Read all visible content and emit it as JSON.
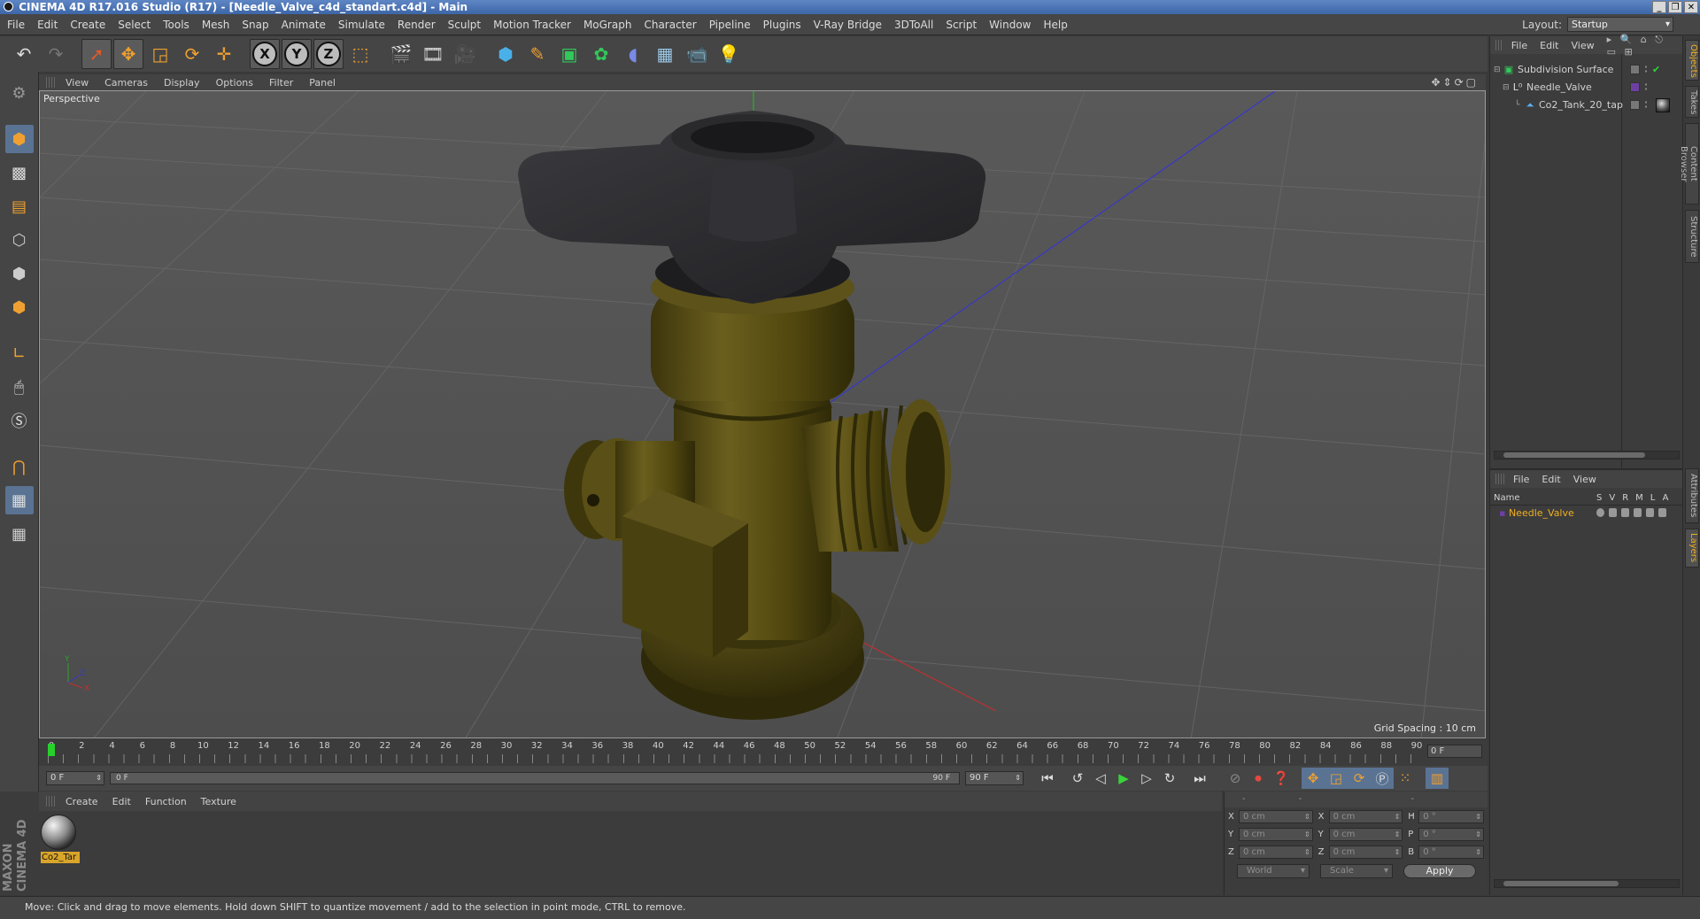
{
  "window": {
    "title": "CINEMA 4D R17.016 Studio (R17) - [Needle_Valve_c4d_standart.c4d] - Main",
    "controls": [
      "_",
      "❐",
      "✕"
    ]
  },
  "menubar": {
    "items": [
      "File",
      "Edit",
      "Create",
      "Select",
      "Tools",
      "Mesh",
      "Snap",
      "Animate",
      "Simulate",
      "Render",
      "Sculpt",
      "Motion Tracker",
      "MoGraph",
      "Character",
      "Pipeline",
      "Plugins",
      "V-Ray Bridge",
      "3DToAll",
      "Script",
      "Window",
      "Help"
    ],
    "layout_label": "Layout:",
    "layout_value": "Startup"
  },
  "toolbar": {
    "axis_x": "X",
    "axis_y": "Y",
    "axis_z": "Z"
  },
  "viewport": {
    "menu": [
      "View",
      "Cameras",
      "Display",
      "Options",
      "Filter",
      "Panel"
    ],
    "label": "Perspective",
    "grid_spacing": "Grid Spacing : 10 cm",
    "nav_icons": "✥⇕⟳▢",
    "axis_x": "X",
    "axis_y": "Y",
    "axis_z": "Z",
    "colors": {
      "knob": "#2b2b2e",
      "body": "#4e4510",
      "body_highlight": "#6b5f1e",
      "x_axis": "#c03030",
      "y_axis": "#30a030",
      "z_axis": "#3838c8"
    }
  },
  "timeline": {
    "ticks": [
      "0",
      "2",
      "4",
      "6",
      "8",
      "10",
      "12",
      "14",
      "16",
      "18",
      "20",
      "22",
      "24",
      "26",
      "28",
      "30",
      "32",
      "34",
      "36",
      "38",
      "40",
      "42",
      "44",
      "46",
      "48",
      "50",
      "52",
      "54",
      "56",
      "58",
      "60",
      "62",
      "64",
      "66",
      "68",
      "70",
      "72",
      "74",
      "76",
      "78",
      "80",
      "82",
      "84",
      "86",
      "88",
      "90"
    ],
    "current_frame": "0 F"
  },
  "transport": {
    "start_field": "0 F",
    "range_lo": "0 F",
    "range_hi": "90 F",
    "end_field": "90 F"
  },
  "material_manager": {
    "menu": [
      "Create",
      "Edit",
      "Function",
      "Texture"
    ],
    "logo_top": "MAXON",
    "logo_bottom": "CINEMA 4D",
    "material_name": "Co2_Tar"
  },
  "coordinates": {
    "header": "-- -- --",
    "rows": [
      {
        "a": "X",
        "a_val": "0 cm",
        "b": "X",
        "b_val": "0 cm",
        "c": "H",
        "c_val": "0 °"
      },
      {
        "a": "Y",
        "a_val": "0 cm",
        "b": "Y",
        "b_val": "0 cm",
        "c": "P",
        "c_val": "0 °"
      },
      {
        "a": "Z",
        "a_val": "0 cm",
        "b": "Z",
        "b_val": "0 cm",
        "c": "B",
        "c_val": "0 °"
      }
    ],
    "space_dropdown": "World",
    "mode_dropdown": "Scale",
    "apply_label": "Apply"
  },
  "object_manager": {
    "menu": [
      "File",
      "Edit",
      "View"
    ],
    "objects": [
      {
        "name": "Subdivision Surface",
        "indent": 0
      },
      {
        "name": "Needle_Valve",
        "indent": 1
      },
      {
        "name": "Co2_Tank_20_tap",
        "indent": 2
      }
    ]
  },
  "layer_manager": {
    "menu": [
      "File",
      "Edit",
      "View"
    ],
    "col_name": "Name",
    "col_flags": "SVRMLA",
    "layers": [
      "Needle_Valve"
    ]
  },
  "side_tabs": [
    "Objects",
    "Takes",
    "Content Browser",
    "Structure",
    "Attributes",
    "Layers"
  ],
  "status": {
    "text": "Move: Click and drag to move elements. Hold down SHIFT to quantize movement / add to the selection in point mode, CTRL to remove."
  }
}
